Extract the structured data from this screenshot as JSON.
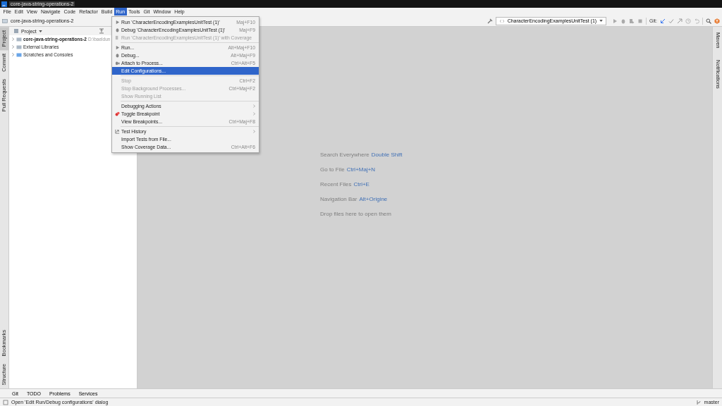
{
  "window": {
    "title": "core-java-string-operations-2"
  },
  "menu_bar": [
    {
      "label": "File",
      "selected": false
    },
    {
      "label": "Edit",
      "selected": false
    },
    {
      "label": "View",
      "selected": false
    },
    {
      "label": "Navigate",
      "selected": false
    },
    {
      "label": "Code",
      "selected": false
    },
    {
      "label": "Refactor",
      "selected": false
    },
    {
      "label": "Build",
      "selected": false
    },
    {
      "label": "Run",
      "selected": true
    },
    {
      "label": "Tools",
      "selected": false
    },
    {
      "label": "Git",
      "selected": false
    },
    {
      "label": "Window",
      "selected": false
    },
    {
      "label": "Help",
      "selected": false
    }
  ],
  "nav_bar": {
    "breadcrumb": "core-java-string-operations-2"
  },
  "toolbar": {
    "run_config": "CharacterEncodingExamplesUnitTest (1)",
    "git_label": "Git:"
  },
  "left_strip": [
    {
      "label": "Project",
      "selected": true
    },
    {
      "label": "Commit",
      "selected": false
    },
    {
      "label": "Pull Requests",
      "selected": false
    }
  ],
  "left_strip_bottom": [
    {
      "label": "Bookmarks"
    },
    {
      "label": "Structure"
    }
  ],
  "right_strip": [
    {
      "label": "Maven"
    },
    {
      "label": "Notifications"
    }
  ],
  "project_panel": {
    "title": "Project",
    "tree": [
      {
        "label": "core-java-string-operations-2",
        "path": "D:\\baeldun",
        "bold": true,
        "expanded": false
      },
      {
        "label": "External Libraries",
        "bold": false,
        "expanded": false
      },
      {
        "label": "Scratches and Consoles",
        "bold": false,
        "expanded": false
      }
    ]
  },
  "run_menu": [
    {
      "kind": "item",
      "label": "Run 'CharacterEncodingExamplesUnitTest (1)'",
      "shortcut": "Maj+F10",
      "disabled": false,
      "selected": false,
      "submenu": false
    },
    {
      "kind": "item",
      "label": "Debug 'CharacterEncodingExamplesUnitTest (1)'",
      "shortcut": "Maj+F9",
      "disabled": false,
      "selected": false,
      "submenu": false
    },
    {
      "kind": "item",
      "label": "Run 'CharacterEncodingExamplesUnitTest (1)' with Coverage",
      "disabled": true,
      "selected": false,
      "submenu": false
    },
    {
      "kind": "separator"
    },
    {
      "kind": "item",
      "label": "Run...",
      "shortcut": "Alt+Maj+F10",
      "disabled": false,
      "selected": false,
      "submenu": false
    },
    {
      "kind": "item",
      "label": "Debug...",
      "shortcut": "Alt+Maj+F9",
      "disabled": false,
      "selected": false,
      "submenu": false
    },
    {
      "kind": "item",
      "label": "Attach to Process...",
      "shortcut": "Ctrl+Alt+F5",
      "disabled": false,
      "selected": false,
      "submenu": false
    },
    {
      "kind": "item",
      "label": "Edit Configurations...",
      "disabled": false,
      "selected": true,
      "submenu": false
    },
    {
      "kind": "separator"
    },
    {
      "kind": "item",
      "label": "Stop",
      "shortcut": "Ctrl+F2",
      "disabled": true,
      "selected": false,
      "submenu": false
    },
    {
      "kind": "item",
      "label": "Stop Background Processes...",
      "shortcut": "Ctrl+Maj+F2",
      "disabled": true,
      "selected": false,
      "submenu": false
    },
    {
      "kind": "item",
      "label": "Show Running List",
      "disabled": true,
      "selected": false,
      "submenu": false
    },
    {
      "kind": "separator"
    },
    {
      "kind": "item",
      "label": "Debugging Actions",
      "disabled": false,
      "selected": false,
      "submenu": true
    },
    {
      "kind": "item",
      "label": "Toggle Breakpoint",
      "disabled": false,
      "selected": false,
      "submenu": true
    },
    {
      "kind": "item",
      "label": "View Breakpoints...",
      "shortcut": "Ctrl+Maj+F8",
      "disabled": false,
      "selected": false,
      "submenu": false
    },
    {
      "kind": "separator"
    },
    {
      "kind": "item",
      "label": "Test History",
      "disabled": false,
      "selected": false,
      "submenu": true
    },
    {
      "kind": "item",
      "label": "Import Tests from File...",
      "disabled": false,
      "selected": false,
      "submenu": false
    },
    {
      "kind": "item",
      "label": "Show Coverage Data...",
      "shortcut": "Ctrl+Alt+F6",
      "disabled": false,
      "selected": false,
      "submenu": false
    }
  ],
  "editor_hints": [
    {
      "text": "Search Everywhere",
      "shortcut": "Double Shift"
    },
    {
      "text": "Go to File",
      "shortcut": "Ctrl+Maj+N"
    },
    {
      "text": "Recent Files",
      "shortcut": "Ctrl+E"
    },
    {
      "text": "Navigation Bar",
      "shortcut": "Alt+Origine"
    },
    {
      "text": "Drop files here to open them"
    }
  ],
  "bottom_tools": [
    "Git",
    "TODO",
    "Problems",
    "Services"
  ],
  "status_bar": {
    "message": "Open 'Edit Run/Debug configurations' dialog",
    "branch": "master"
  }
}
